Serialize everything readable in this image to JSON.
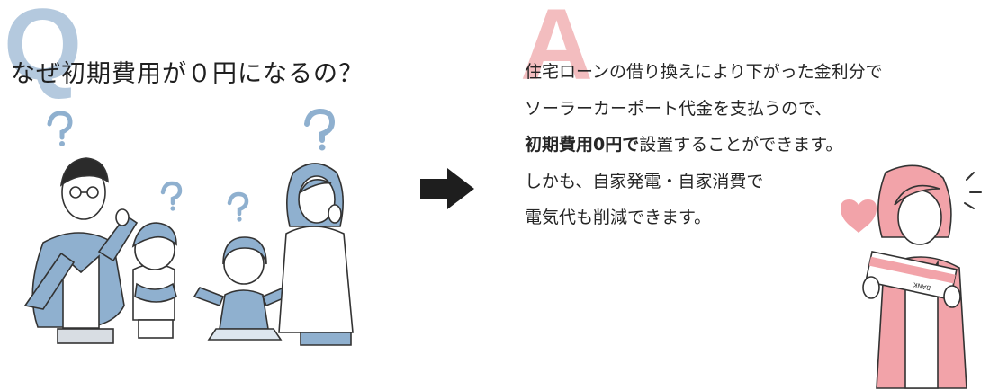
{
  "question": {
    "badge": "Q",
    "text": "なぜ初期費用が０円になるの？"
  },
  "answer": {
    "badge": "A",
    "line1": "住宅ローンの借り換えにより下がった金利分で",
    "line2": "ソーラーカーポート代金を支払うので、",
    "line3_bold": "初期費用0円で",
    "line3_rest": "設置することができます。",
    "line4": "しかも、自家発電・自家消費で",
    "line5": "電気代も削減できます。"
  },
  "illustrations": {
    "family": "puzzled-family-illustration",
    "arrow": "right-arrow-icon",
    "woman": "woman-with-bank-book-illustration",
    "bank_book_label": "BANK"
  },
  "colors": {
    "q_badge": "#9cb8d3",
    "a_badge": "#f0a7aa",
    "family_blue": "#8fb0cf",
    "pink": "#f2a3a9",
    "arrow": "#1e1e1e"
  }
}
